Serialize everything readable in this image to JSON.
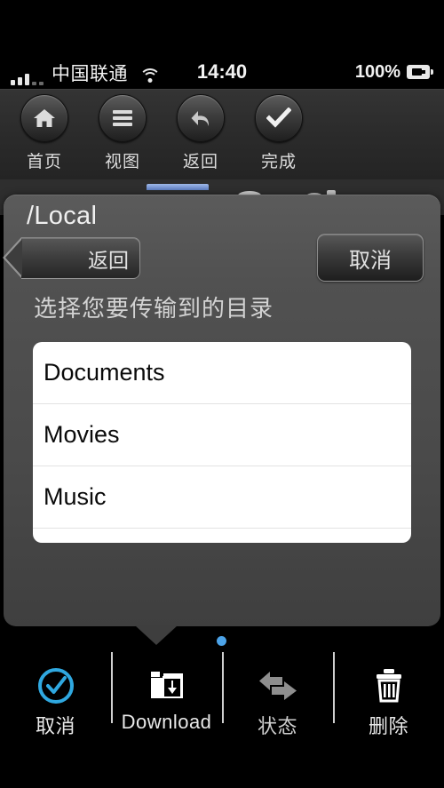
{
  "status_bar": {
    "carrier": "中国联通",
    "time": "14:40",
    "battery_percent": "100%",
    "signal_icon": "signal-bars-icon",
    "wifi_icon": "wifi-icon",
    "battery_icon": "battery-charging-icon"
  },
  "top_toolbar": {
    "items": [
      {
        "label": "首页",
        "icon": "home-icon"
      },
      {
        "label": "视图",
        "icon": "list-view-icon"
      },
      {
        "label": "返回",
        "icon": "undo-arrow-icon"
      },
      {
        "label": "完成",
        "icon": "checkmark-icon"
      }
    ]
  },
  "popover": {
    "title": "/Local",
    "back_label": "返回",
    "cancel_label": "取消",
    "prompt": "选择您要传输到的目录",
    "directories": [
      "Documents",
      "Movies",
      "Music"
    ]
  },
  "page_indicator": {
    "dot_color": "#4ca3e8"
  },
  "bottom_toolbar": {
    "items": [
      {
        "label": "取消",
        "icon": "circle-check-icon",
        "color": "#2fa8e0"
      },
      {
        "label": "Download",
        "icon": "folder-download-icon",
        "color": "#ffffff"
      },
      {
        "label": "状态",
        "icon": "transfer-arrows-icon",
        "color": "#8e8e8e"
      },
      {
        "label": "删除",
        "icon": "trash-icon",
        "color": "#ffffff"
      }
    ]
  }
}
